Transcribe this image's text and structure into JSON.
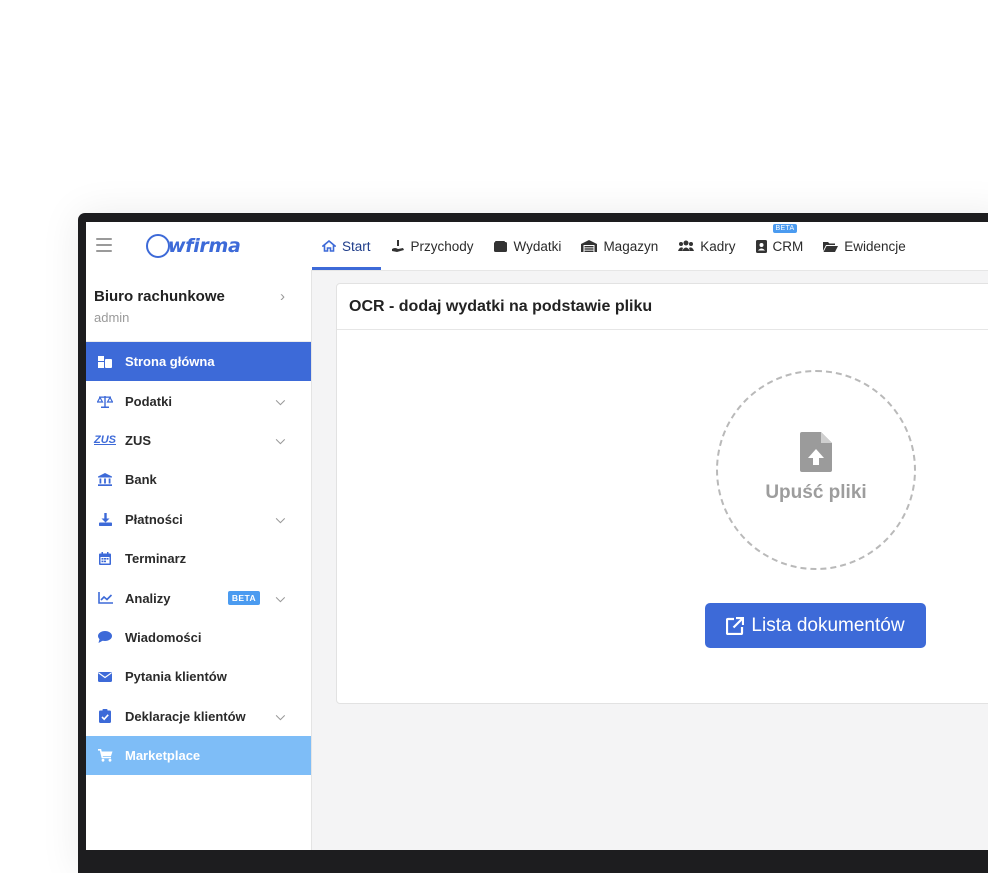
{
  "app": {
    "logo_text": "wfirma"
  },
  "nav": {
    "items": [
      {
        "label": "Start",
        "icon": "home-icon",
        "active": true
      },
      {
        "label": "Przychody",
        "icon": "hand-money-icon"
      },
      {
        "label": "Wydatki",
        "icon": "wallet-icon"
      },
      {
        "label": "Magazyn",
        "icon": "warehouse-icon"
      },
      {
        "label": "Kadry",
        "icon": "users-icon"
      },
      {
        "label": "CRM",
        "icon": "address-book-icon",
        "badge": "BETA"
      },
      {
        "label": "Ewidencje",
        "icon": "folder-open-icon"
      }
    ]
  },
  "sidebar": {
    "account": {
      "name": "Biuro rachunkowe",
      "role": "admin"
    },
    "items": [
      {
        "label": "Strona główna",
        "icon": "dashboard-icon",
        "active": true
      },
      {
        "label": "Podatki",
        "icon": "balance-scale-icon",
        "expandable": true
      },
      {
        "label": "ZUS",
        "icon": "zus-logo-icon",
        "expandable": true,
        "icon_text": "ZUS"
      },
      {
        "label": "Bank",
        "icon": "bank-icon"
      },
      {
        "label": "Płatności",
        "icon": "download-icon",
        "expandable": true
      },
      {
        "label": "Terminarz",
        "icon": "calendar-icon"
      },
      {
        "label": "Analizy",
        "icon": "chart-line-icon",
        "expandable": true,
        "badge": "BETA"
      },
      {
        "label": "Wiadomości",
        "icon": "comment-icon"
      },
      {
        "label": "Pytania klientów",
        "icon": "envelope-icon"
      },
      {
        "label": "Deklaracje klientów",
        "icon": "clipboard-check-icon",
        "expandable": true
      },
      {
        "label": "Marketplace",
        "icon": "cart-icon"
      }
    ]
  },
  "main": {
    "card_title": "OCR - dodaj wydatki na podstawie pliku",
    "dropzone_label": "Upuść pliki",
    "docs_button": "Lista dokumentów"
  },
  "colors": {
    "accent": "#3d6ad8",
    "marketplace": "#7ebdf7",
    "beta": "#4b9bf0"
  }
}
